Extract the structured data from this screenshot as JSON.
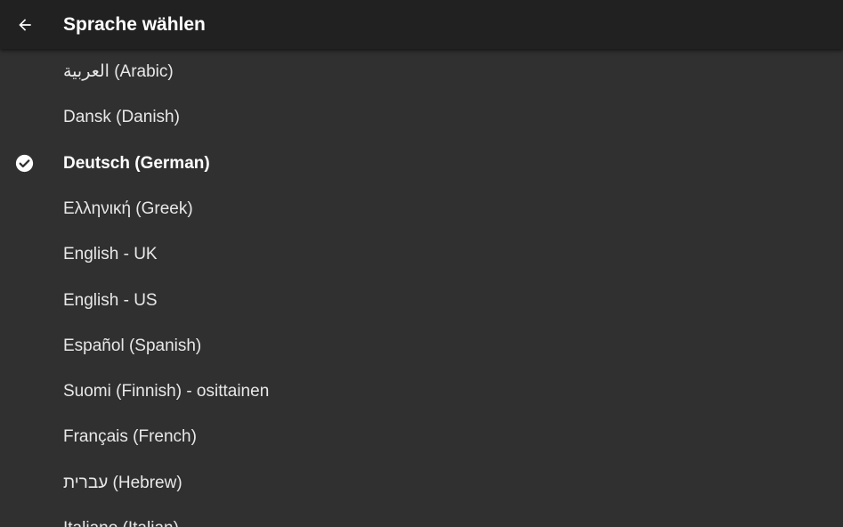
{
  "appbar": {
    "back_icon": "arrow-left-icon",
    "title": "Sprache wählen"
  },
  "languages": [
    {
      "label": "العربية (Arabic)",
      "selected": false
    },
    {
      "label": "Dansk (Danish)",
      "selected": false
    },
    {
      "label": "Deutsch (German)",
      "selected": true
    },
    {
      "label": "Ελληνική (Greek)",
      "selected": false
    },
    {
      "label": "English - UK",
      "selected": false
    },
    {
      "label": "English - US",
      "selected": false
    },
    {
      "label": "Español (Spanish)",
      "selected": false
    },
    {
      "label": "Suomi (Finnish) - osittainen",
      "selected": false
    },
    {
      "label": "Français (French)",
      "selected": false
    },
    {
      "label": "עברית (Hebrew)",
      "selected": false
    },
    {
      "label": "Italiano (Italian)",
      "selected": false
    }
  ],
  "selected_icon": "check-circle-icon",
  "colors": {
    "background": "#303030",
    "appbar": "#212121",
    "text": "#ffffff"
  }
}
